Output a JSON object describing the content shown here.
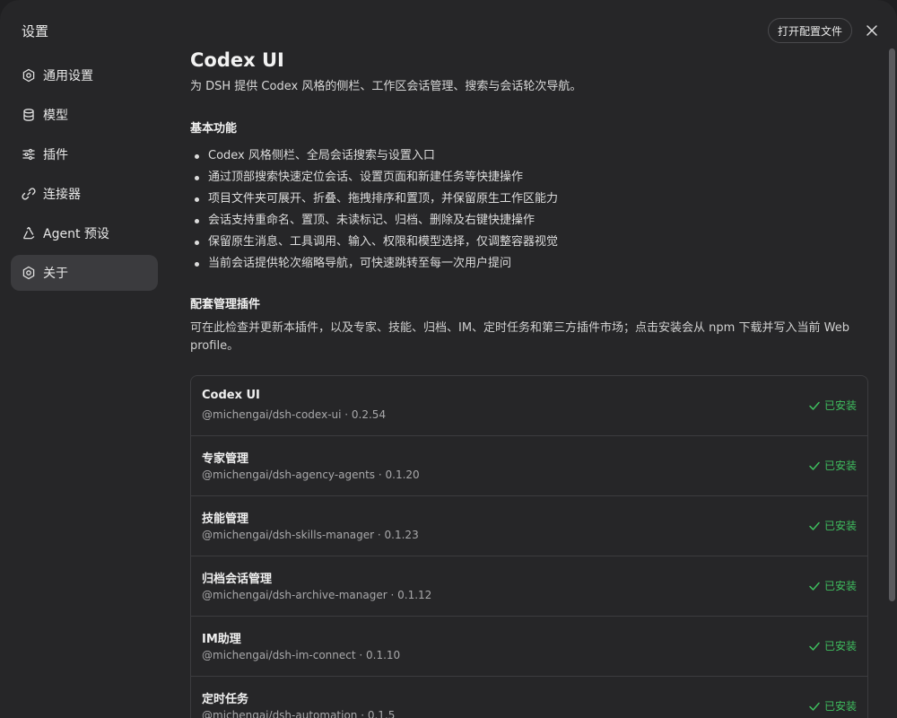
{
  "sidebar": {
    "title": "设置",
    "items": [
      {
        "label": "通用设置",
        "icon": "gear-icon"
      },
      {
        "label": "模型",
        "icon": "database-icon"
      },
      {
        "label": "插件",
        "icon": "sliders-icon"
      },
      {
        "label": "连接器",
        "icon": "link-icon"
      },
      {
        "label": "Agent 预设",
        "icon": "recycle-icon"
      },
      {
        "label": "关于",
        "icon": "gear-icon",
        "active": true
      }
    ]
  },
  "header": {
    "open_config_label": "打开配置文件",
    "close_icon": "close-icon"
  },
  "main": {
    "title": "Codex UI",
    "description": "为 DSH 提供 Codex 风格的侧栏、工作区会话管理、搜索与会话轮次导航。",
    "features_title": "基本功能",
    "features": [
      "Codex 风格侧栏、全局会话搜索与设置入口",
      "通过顶部搜索快速定位会话、设置页面和新建任务等快捷操作",
      "项目文件夹可展开、折叠、拖拽排序和置顶，并保留原生工作区能力",
      "会话支持重命名、置顶、未读标记、归档、删除及右键快捷操作",
      "保留原生消息、工具调用、输入、权限和模型选择，仅调整容器视觉",
      "当前会话提供轮次缩略导航，可快速跳转至每一次用户提问"
    ],
    "plugins_title": "配套管理插件",
    "plugins_desc": "可在此检查并更新本插件，以及专家、技能、归档、IM、定时任务和第三方插件市场；点击安装会从 npm 下载并写入当前 Web profile。",
    "status_color": "#3fbf5f",
    "plugins": [
      {
        "name": "Codex UI",
        "meta": "@michengai/dsh-codex-ui · 0.2.54",
        "status": "已安装"
      },
      {
        "name": "专家管理",
        "meta": "@michengai/dsh-agency-agents · 0.1.20",
        "status": "已安装"
      },
      {
        "name": "技能管理",
        "meta": "@michengai/dsh-skills-manager · 0.1.23",
        "status": "已安装"
      },
      {
        "name": "归档会话管理",
        "meta": "@michengai/dsh-archive-manager · 0.1.12",
        "status": "已安装"
      },
      {
        "name": "IM助理",
        "meta": "@michengai/dsh-im-connect · 0.1.10",
        "status": "已安装"
      },
      {
        "name": "定时任务",
        "meta": "@michengai/dsh-automation · 0.1.5",
        "status": "已安装"
      }
    ]
  }
}
